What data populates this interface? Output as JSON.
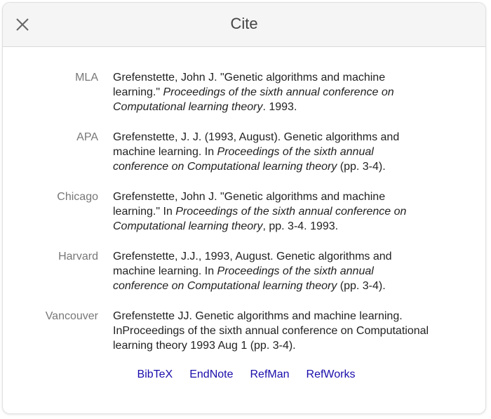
{
  "dialog": {
    "title": "Cite",
    "close_icon": "close-icon"
  },
  "citations": [
    {
      "label": "MLA",
      "parts": [
        {
          "text": "Grefenstette, John J. \"Genetic algorithms and machine learning.\" ",
          "italic": false
        },
        {
          "text": "Proceedings of the sixth annual conference on Computational learning theory",
          "italic": true
        },
        {
          "text": ". 1993.",
          "italic": false
        }
      ]
    },
    {
      "label": "APA",
      "parts": [
        {
          "text": "Grefenstette, J. J. (1993, August). Genetic algorithms and machine learning. In ",
          "italic": false
        },
        {
          "text": "Proceedings of the sixth annual conference on Computational learning theory",
          "italic": true
        },
        {
          "text": " (pp. 3-4).",
          "italic": false
        }
      ]
    },
    {
      "label": "Chicago",
      "parts": [
        {
          "text": "Grefenstette, John J. \"Genetic algorithms and machine learning.\" In ",
          "italic": false
        },
        {
          "text": "Proceedings of the sixth annual conference on Computational learning theory",
          "italic": true
        },
        {
          "text": ", pp. 3-4. 1993.",
          "italic": false
        }
      ]
    },
    {
      "label": "Harvard",
      "parts": [
        {
          "text": "Grefenstette, J.J., 1993, August. Genetic algorithms and machine learning. In ",
          "italic": false
        },
        {
          "text": "Proceedings of the sixth annual conference on Computational learning theory",
          "italic": true
        },
        {
          "text": " (pp. 3-4).",
          "italic": false
        }
      ]
    },
    {
      "label": "Vancouver",
      "parts": [
        {
          "text": "Grefenstette JJ. Genetic algorithms and machine learning. InProceedings of the sixth annual conference on Computational learning theory 1993 Aug 1 (pp. 3-4).",
          "italic": false
        }
      ]
    }
  ],
  "export_links": [
    {
      "label": "BibTeX"
    },
    {
      "label": "EndNote"
    },
    {
      "label": "RefMan"
    },
    {
      "label": "RefWorks"
    }
  ],
  "colors": {
    "header_bg": "#f5f5f5",
    "label": "#777777",
    "text": "#222222",
    "link": "#1a0dab"
  }
}
